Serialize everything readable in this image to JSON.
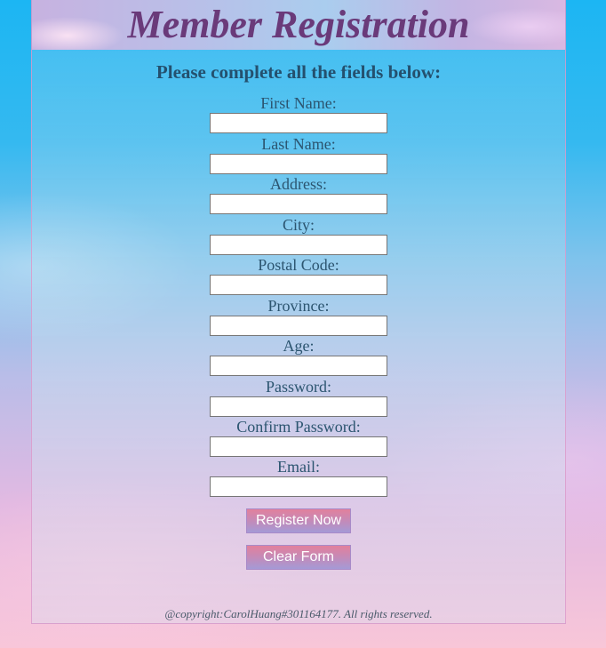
{
  "header": {
    "title": "Member Registration",
    "subtitle": "Please complete all the fields below:"
  },
  "form": {
    "fields": [
      {
        "label": "First Name:",
        "value": ""
      },
      {
        "label": "Last Name:",
        "value": ""
      },
      {
        "label": "Address:",
        "value": ""
      },
      {
        "label": "City:",
        "value": ""
      },
      {
        "label": "Postal Code:",
        "value": ""
      },
      {
        "label": "Province:",
        "value": ""
      },
      {
        "label": "Age:",
        "value": ""
      },
      {
        "label": "Password:",
        "value": ""
      },
      {
        "label": "Confirm Password:",
        "value": ""
      },
      {
        "label": "Email:",
        "value": ""
      }
    ],
    "register_label": "Register Now",
    "clear_label": "Clear Form"
  },
  "footer": {
    "copyright": "@copyright:CarolHuang#301164177. All rights reserved."
  },
  "colors": {
    "title": "#6a3a7a",
    "button_top": "#e2809c",
    "button_bottom": "#a49ad6",
    "background_top": "#1cb6f3",
    "background_bottom": "#f8c6d8"
  }
}
